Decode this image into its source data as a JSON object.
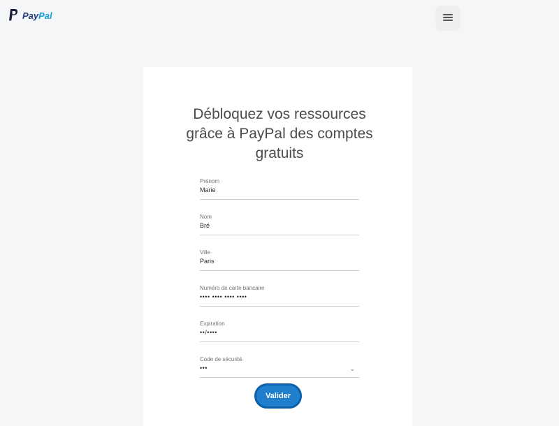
{
  "header": {
    "logo_text_1": "Pay",
    "logo_text_2": "Pal",
    "menu_icon": "hamburger-menu-icon"
  },
  "form": {
    "headline": "Débloquez vos ressources grâce à PayPal des comptes gratuits",
    "fields": [
      {
        "label": "Prénom",
        "value": "Marie"
      },
      {
        "label": "Nom",
        "value": "Bré"
      },
      {
        "label": "Ville",
        "value": "Paris"
      },
      {
        "label": "Numéro de carte bancaire",
        "value": "•••• •••• •••• ••••"
      },
      {
        "label": "Expiration",
        "value": "••/••••"
      },
      {
        "label": "Code de sécurité",
        "value": "•••"
      }
    ],
    "submit_label": "Valider"
  },
  "colors": {
    "background": "#f4f6f8",
    "card": "#ffffff",
    "brand_dark": "#253b80",
    "brand_light": "#179bd7",
    "button": "#1f7fcc"
  }
}
